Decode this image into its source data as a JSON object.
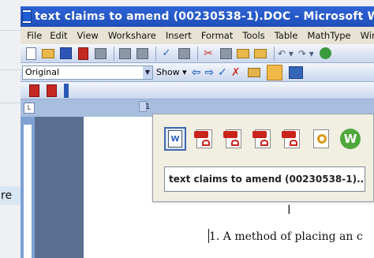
{
  "background": {
    "partial_text": "re"
  },
  "window": {
    "title": "text claims to amend (00230538-1).DOC - Microsoft Word"
  },
  "menu": [
    "File",
    "Edit",
    "View",
    "Workshare",
    "Insert",
    "Format",
    "Tools",
    "Table",
    "MathType",
    "Wind"
  ],
  "formatting": {
    "style_value": "Original",
    "show_label": "Show ▾"
  },
  "ruler": {
    "corner_label": "L",
    "number": "1"
  },
  "floating_panel": {
    "document_name": "text claims to amend (00230538-1)...."
  },
  "document": {
    "first_line": "1. A method of placing an c"
  },
  "icons": {
    "word": "word-icon",
    "pdf": "pdf-icon",
    "search": "search-pdf-icon",
    "w": "workshare-icon"
  }
}
